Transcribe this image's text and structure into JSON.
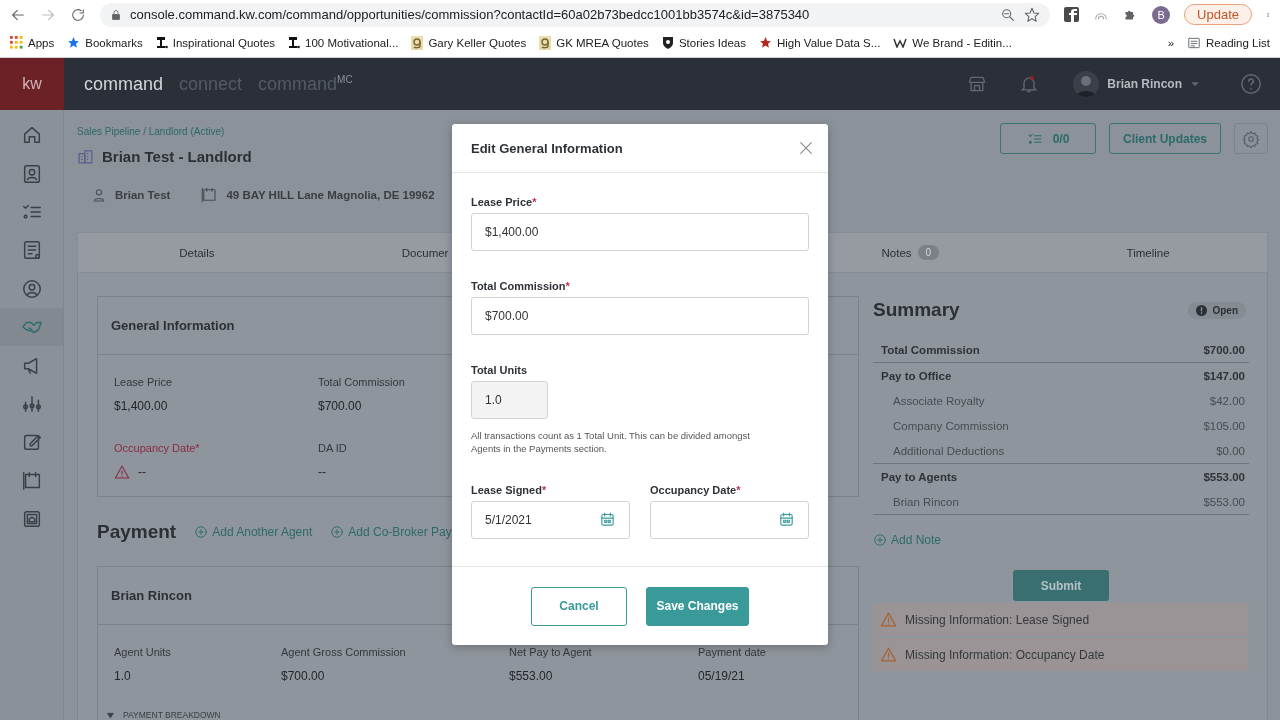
{
  "browser": {
    "address": "console.command.kw.com/command/opportunities/commission?contactId=60a02b73bedcc1001bb3574c&id=3875340",
    "profile_initial": "B",
    "update_button": "Update",
    "overflow": "»",
    "reading_list": "Reading List",
    "bookmarks": [
      {
        "label": "Apps",
        "kind": "grid"
      },
      {
        "label": "Bookmarks",
        "kind": "star",
        "color": "#1a73e8"
      },
      {
        "label": "Inspirational Quotes",
        "kind": "glyph"
      },
      {
        "label": "100 Motivational...",
        "kind": "glyph"
      },
      {
        "label": "Gary Keller Quotes",
        "kind": "tile"
      },
      {
        "label": "GK MREA Quotes",
        "kind": "tile"
      },
      {
        "label": "Stories Ideas",
        "kind": "shield"
      },
      {
        "label": "High Value Data S...",
        "kind": "star",
        "color": "#b3261e"
      },
      {
        "label": "We Brand - Editin...",
        "kind": "wave"
      }
    ]
  },
  "header": {
    "logo": "kw",
    "nav": [
      {
        "label": "command",
        "selected": true
      },
      {
        "label": "connect",
        "selected": false
      },
      {
        "label": "command$^{MC}$",
        "selected": false
      }
    ],
    "user_name": "Brian Rincon"
  },
  "sidebar": {
    "items": [
      {
        "selected": false
      },
      {
        "selected": false
      },
      {
        "selected": false
      },
      {
        "selected": false
      },
      {
        "selected": false
      },
      {
        "selected": true
      },
      {
        "selected": false
      },
      {
        "selected": false
      },
      {
        "selected": false
      },
      {
        "selected": false
      },
      {
        "selected": false
      }
    ]
  },
  "page": {
    "breadcrumb": "Sales Pipeline / Landlord (Active)",
    "title": "Brian Test - Landlord",
    "contact": "Brian Test",
    "address": "49 BAY HILL Lane Magnolia, DE 19962",
    "tasks": "0/0",
    "client_updates": "Client Updates",
    "tabs": [
      {
        "label": "Details",
        "selected": false
      },
      {
        "label": "Documer",
        "selected": false
      },
      {
        "label": "Notes",
        "count": "0",
        "selected": false
      },
      {
        "label": "Timeline",
        "selected": false
      }
    ],
    "general_info": {
      "title": "General Information",
      "fields": [
        {
          "label": "Lease Price",
          "value": "$1,400.00",
          "missing": false
        },
        {
          "label": "Total Commission",
          "value": "$700.00",
          "missing": false
        },
        {
          "label": "Occupancy Date",
          "required_mark": "*",
          "value": "--",
          "missing": true
        },
        {
          "label": "DA ID",
          "value": "--",
          "missing": false
        }
      ]
    },
    "payment": {
      "title": "Payment",
      "actions": [
        "Add Another Agent",
        "Add Co-Broker Pay"
      ],
      "agent": {
        "name": "Brian Rincon",
        "fields": [
          {
            "label": "Agent Units",
            "value": "1.0"
          },
          {
            "label": "Agent Gross Commission",
            "value": "$700.00"
          },
          {
            "label": "Net Pay to Agent",
            "value": "$553.00"
          },
          {
            "label": "Payment date",
            "value": "05/19/21"
          }
        ],
        "breakdown": "PAYMENT BREAKDOWN",
        "breakdown_expanded": true
      }
    },
    "summary": {
      "title": "Summary",
      "status": "Open",
      "rows": [
        {
          "kind": "total",
          "label": "Total Commission",
          "value": "$700.00"
        },
        {
          "kind": "group",
          "label": "Pay to Office",
          "value": "$147.00"
        },
        {
          "kind": "item",
          "label": "Associate Royalty",
          "value": "$42.00"
        },
        {
          "kind": "item",
          "label": "Company Commission",
          "value": "$105.00"
        },
        {
          "kind": "item",
          "label": "Additional Deductions",
          "value": "$0.00"
        },
        {
          "kind": "group",
          "label": "Pay to Agents",
          "value": "$553.00"
        },
        {
          "kind": "item",
          "label": "Brian Rincon",
          "value": "$553.00"
        }
      ],
      "add_note": "Add Note",
      "submit": "Submit",
      "alerts": [
        "Missing Information: Lease Signed",
        "Missing Information: Occupancy Date"
      ]
    }
  },
  "modal": {
    "title": "Edit General Information",
    "fields": [
      {
        "kind": "text",
        "label": "Lease Price",
        "required_mark": "*",
        "value": "$1,400.00"
      },
      {
        "kind": "readonly",
        "label": "Total Commission",
        "required_mark": "*",
        "value": "$700.00",
        "disabled": false
      },
      {
        "kind": "readonly",
        "label": "Total Units",
        "value": "1.0",
        "disabled": true,
        "hint": "All transactions count as 1 Total Unit. This can be divided amongst Agents in the Payments section."
      },
      {
        "kind": "date",
        "label": "Lease Signed",
        "required_mark": "*",
        "value": "5/1/2021"
      },
      {
        "kind": "date",
        "label": "Occupancy Date",
        "required_mark": "*"
      }
    ],
    "buttons": [
      {
        "kind": "secondary",
        "label": "Cancel"
      },
      {
        "kind": "primary",
        "label": "Save Changes"
      }
    ]
  }
}
